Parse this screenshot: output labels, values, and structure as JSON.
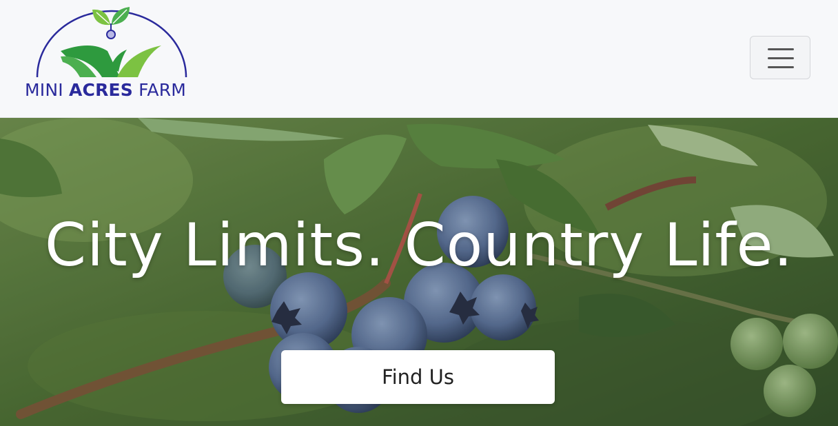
{
  "nav": {
    "brand_word_1": "MINI ",
    "brand_word_2": "ACRES",
    "brand_word_3": " FARM",
    "menu_icon": "hamburger-menu-icon"
  },
  "hero": {
    "headline": "City Limits. Country Life.",
    "cta_label": "Find Us",
    "background": "blueberry-bush-photo"
  },
  "colors": {
    "brand_blue": "#2a2a9c",
    "leaf_green": "#7cc242",
    "field_green": "#2e9a3e"
  }
}
